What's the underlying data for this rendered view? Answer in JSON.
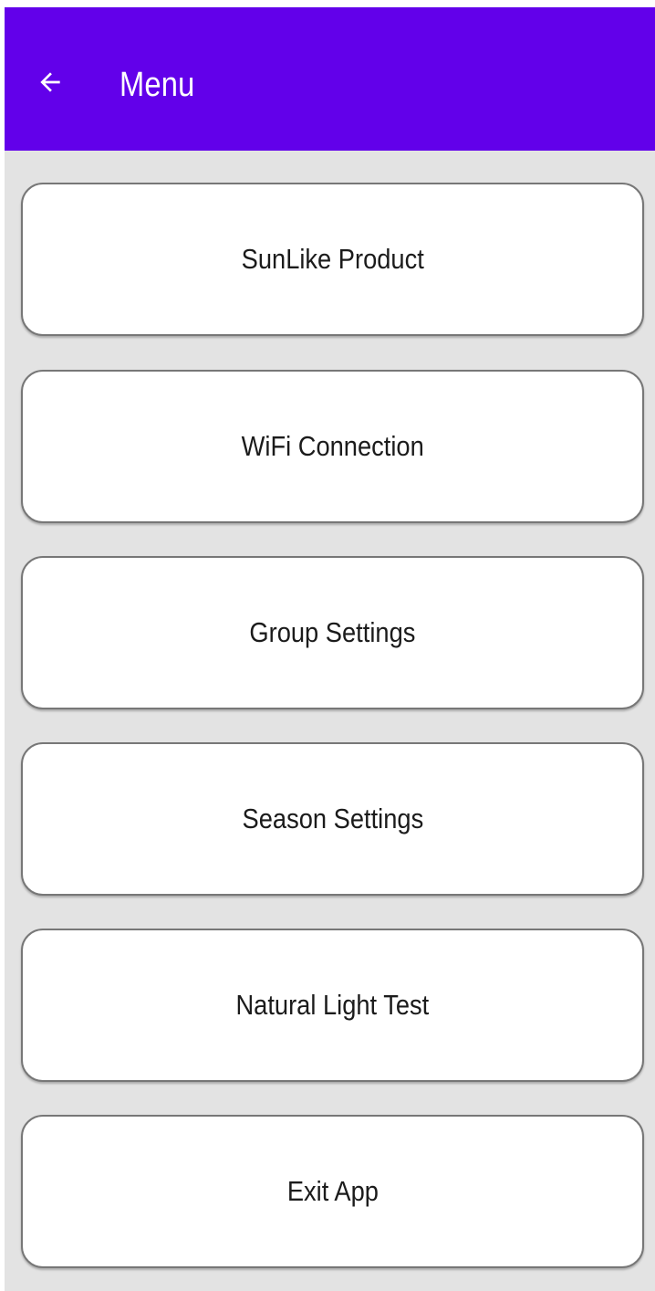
{
  "app_bar": {
    "title": "Menu",
    "back_icon": "arrow-left-icon",
    "color": "#6200ea"
  },
  "menu": {
    "items": [
      {
        "label": "SunLike Product"
      },
      {
        "label": "WiFi Connection"
      },
      {
        "label": "Group Settings"
      },
      {
        "label": "Season Settings"
      },
      {
        "label": "Natural Light Test"
      },
      {
        "label": "Exit App"
      }
    ]
  }
}
